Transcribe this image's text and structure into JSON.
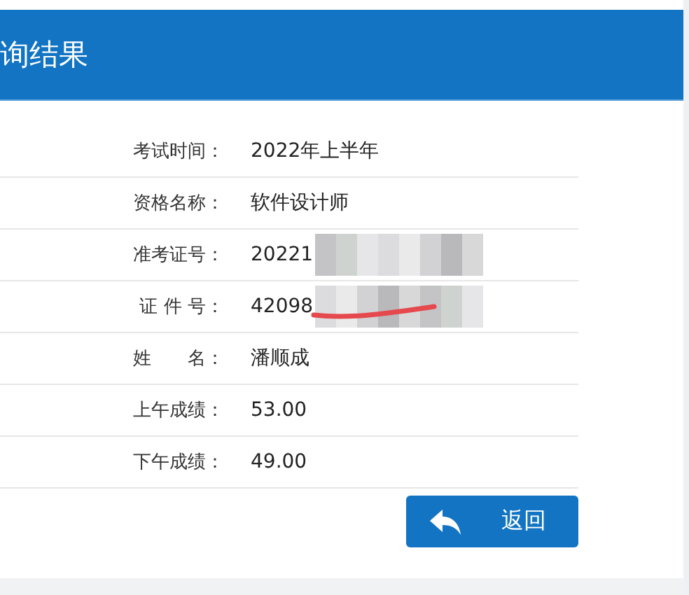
{
  "header": {
    "title": "询结果"
  },
  "rows": [
    {
      "label": "考试时间：",
      "value": "2022年上半年",
      "masked": false,
      "scribbled": false
    },
    {
      "label": "资格名称：",
      "value": "软件设计师",
      "masked": false,
      "scribbled": false
    },
    {
      "label": "准考证号：",
      "value": "20221",
      "masked": true,
      "scribbled": false
    },
    {
      "label": "证 件 号：",
      "value": "42098",
      "masked": true,
      "scribbled": true
    },
    {
      "label": "姓　　名：",
      "value": "潘顺成",
      "masked": false,
      "scribbled": false
    },
    {
      "label": "上午成绩：",
      "value": "53.00",
      "masked": false,
      "scribbled": false
    },
    {
      "label": "下午成绩：",
      "value": "49.00",
      "masked": false,
      "scribbled": false
    }
  ],
  "back_button": {
    "label": "返回"
  }
}
